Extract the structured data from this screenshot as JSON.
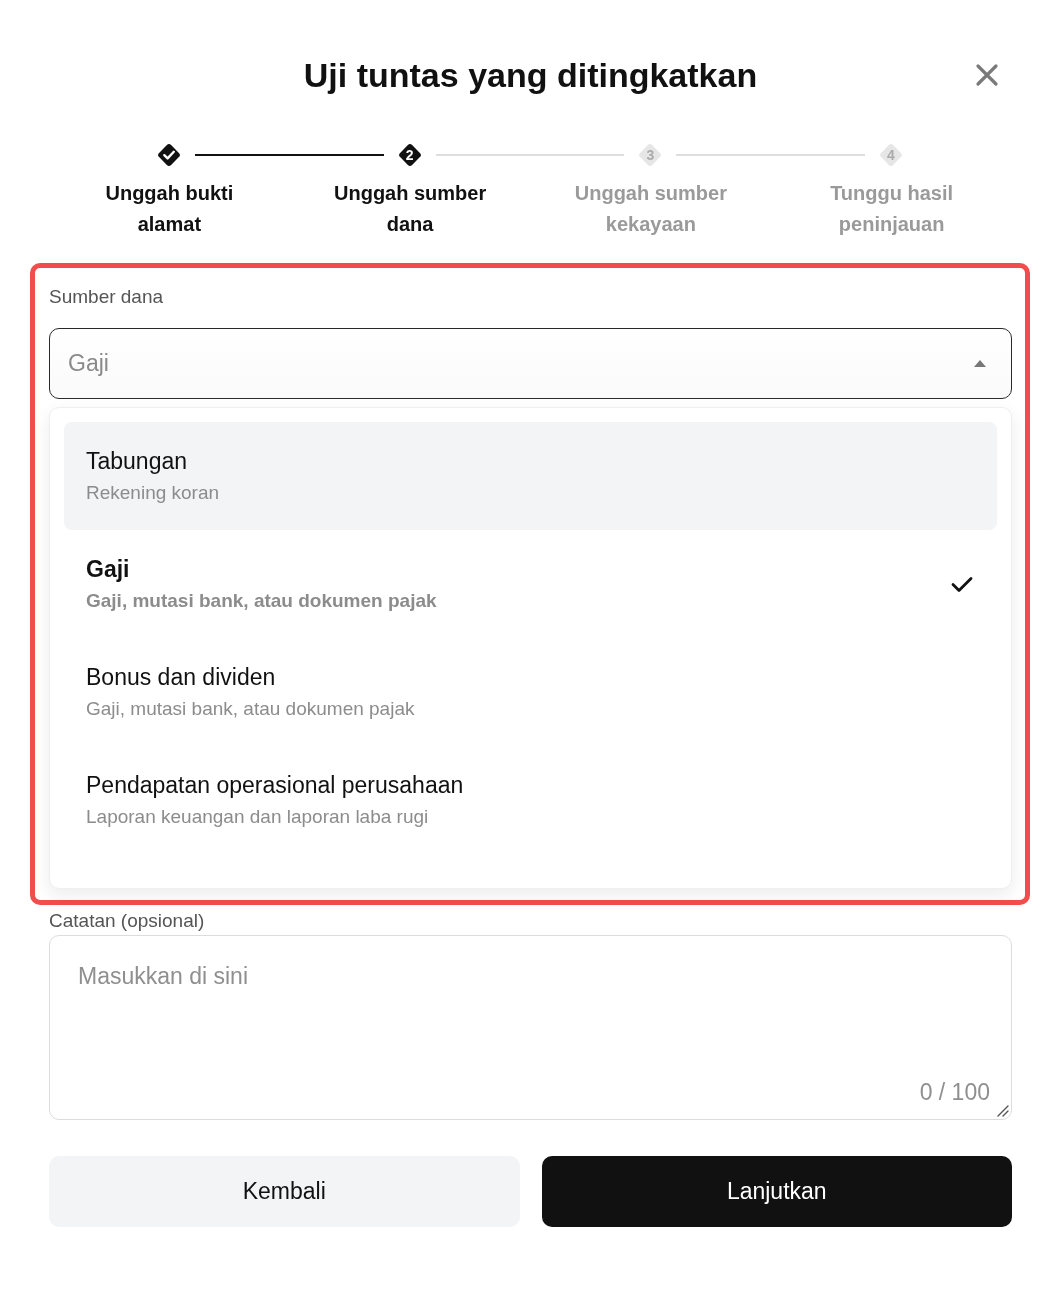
{
  "dialog": {
    "title": "Uji tuntas yang ditingkatkan"
  },
  "steps": [
    {
      "kind": "done",
      "label": "Unggah bukti alamat"
    },
    {
      "kind": "current",
      "number": "2",
      "label": "Unggah sumber dana"
    },
    {
      "kind": "upcoming",
      "number": "3",
      "label": "Unggah sumber kekayaan"
    },
    {
      "kind": "upcoming",
      "number": "4",
      "label": "Tunggu hasil peninjauan"
    }
  ],
  "source_field": {
    "label": "Sumber dana",
    "value": "Gaji",
    "expanded": true
  },
  "options": [
    {
      "title": "Tabungan",
      "description": "Rekening koran",
      "highlighted": true,
      "selected": false
    },
    {
      "title": "Gaji",
      "description": "Gaji, mutasi bank, atau dokumen pajak",
      "highlighted": false,
      "selected": true
    },
    {
      "title": "Bonus dan dividen",
      "description": "Gaji, mutasi bank, atau dokumen pajak",
      "highlighted": false,
      "selected": false
    },
    {
      "title": "Pendapatan operasional perusahaan",
      "description": "Laporan keuangan dan laporan laba rugi",
      "highlighted": false,
      "selected": false
    }
  ],
  "notes_field": {
    "label": "Catatan (opsional)",
    "placeholder": "Masukkan di sini",
    "counter": "0 / 100"
  },
  "buttons": [
    {
      "label": "Kembali",
      "kind": "secondary"
    },
    {
      "label": "Lanjutkan",
      "kind": "primary"
    }
  ]
}
